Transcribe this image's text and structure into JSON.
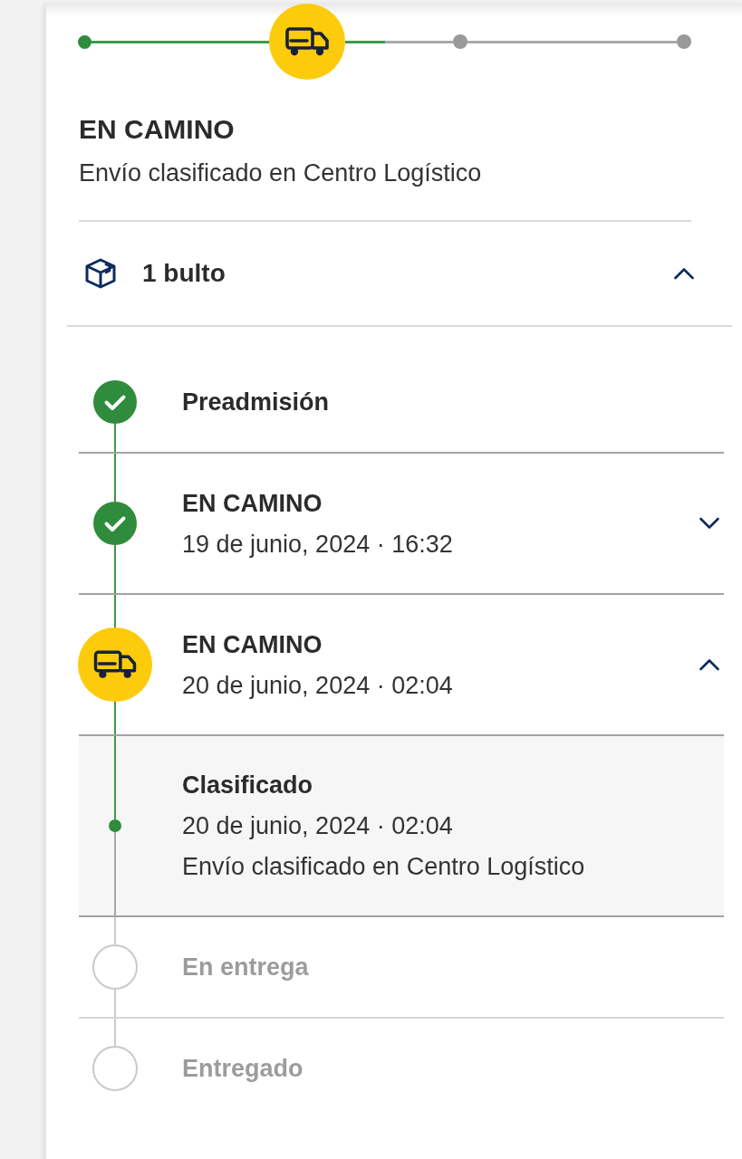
{
  "progress": {
    "steps": [
      {
        "kind": "done"
      },
      {
        "kind": "current"
      },
      {
        "kind": "pending"
      },
      {
        "kind": "pending"
      }
    ],
    "segments": [
      {
        "kind": "done"
      },
      {
        "kind": "active",
        "level": 0.37
      },
      {
        "kind": "pending"
      }
    ]
  },
  "status": {
    "title": "EN CAMINO",
    "description": "Envío clasificado en Centro Logístico"
  },
  "package": {
    "label": "1 bulto",
    "expanded": true
  },
  "events": [
    {
      "title": "Preadmisión",
      "kind": "done"
    },
    {
      "title": "EN CAMINO",
      "date": "19 de junio, 2024 · 16:32",
      "kind": "done",
      "expanded": false
    },
    {
      "title": "EN CAMINO",
      "date": "20 de junio, 2024 · 02:04",
      "kind": "current",
      "expanded": true,
      "children": [
        {
          "title": "Clasificado",
          "date": "20 de junio, 2024 · 02:04",
          "description": "Envío clasificado en Centro Logístico"
        }
      ]
    },
    {
      "title": "En entrega",
      "kind": "pending"
    },
    {
      "title": "Entregado",
      "kind": "pending"
    }
  ]
}
